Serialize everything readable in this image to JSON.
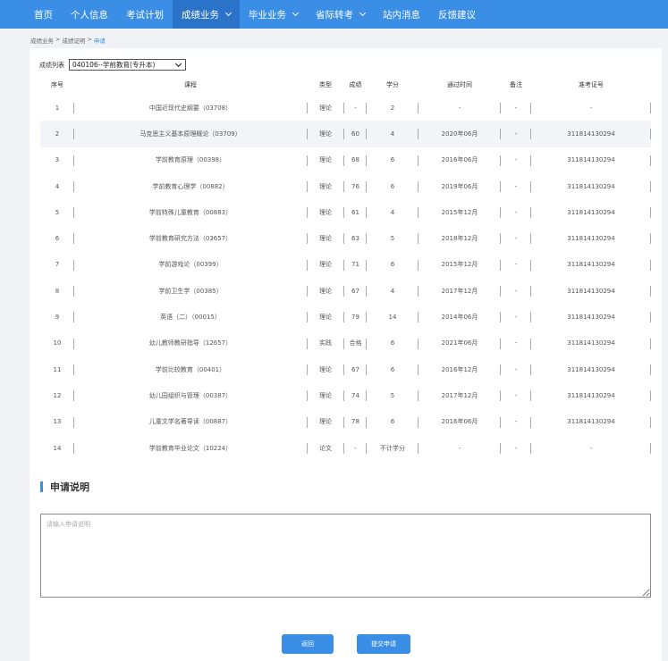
{
  "nav": [
    {
      "label": "首页",
      "dropdown": false,
      "active": false
    },
    {
      "label": "个人信息",
      "dropdown": false,
      "active": false
    },
    {
      "label": "考试计划",
      "dropdown": false,
      "active": false
    },
    {
      "label": "成绩业务",
      "dropdown": true,
      "active": true
    },
    {
      "label": "毕业业务",
      "dropdown": true,
      "active": false
    },
    {
      "label": "省际转考",
      "dropdown": true,
      "active": false
    },
    {
      "label": "站内消息",
      "dropdown": false,
      "active": false
    },
    {
      "label": "反馈建议",
      "dropdown": false,
      "active": false
    }
  ],
  "breadcrumb": {
    "item1": "成绩业务",
    "sep": ">",
    "item2": "成绩证明",
    "current": "申请"
  },
  "filter": {
    "label": "成绩列表",
    "selected": "040106--学前教育(专升本)"
  },
  "table": {
    "headers": {
      "no": "序号",
      "course": "课程",
      "type": "类型",
      "score": "成绩",
      "credit": "学分",
      "date": "通过时间",
      "note": "备注",
      "ticket": "准考证号"
    },
    "rows": [
      {
        "no": "1",
        "course": "中国近现代史纲要（03708）",
        "type": "理论",
        "score": "-",
        "credit": "2",
        "date": "-",
        "note": "-",
        "ticket": "-"
      },
      {
        "no": "2",
        "course": "马克思主义基本原理概论（03709）",
        "type": "理论",
        "score": "60",
        "credit": "4",
        "date": "2020年06月",
        "note": "-",
        "ticket": "311814130294"
      },
      {
        "no": "3",
        "course": "学前教育原理（00398）",
        "type": "理论",
        "score": "68",
        "credit": "6",
        "date": "2016年06月",
        "note": "-",
        "ticket": "311814130294"
      },
      {
        "no": "4",
        "course": "学前教育心理学（00882）",
        "type": "理论",
        "score": "76",
        "credit": "6",
        "date": "2019年06月",
        "note": "-",
        "ticket": "311814130294"
      },
      {
        "no": "5",
        "course": "学前特殊儿童教育（00883）",
        "type": "理论",
        "score": "61",
        "credit": "4",
        "date": "2015年12月",
        "note": "-",
        "ticket": "311814130294"
      },
      {
        "no": "6",
        "course": "学前教育研究方法（03657）",
        "type": "理论",
        "score": "63",
        "credit": "5",
        "date": "2018年12月",
        "note": "-",
        "ticket": "311814130294"
      },
      {
        "no": "7",
        "course": "学前游戏论（00399）",
        "type": "理论",
        "score": "71",
        "credit": "6",
        "date": "2015年12月",
        "note": "-",
        "ticket": "311814130294"
      },
      {
        "no": "8",
        "course": "学前卫生学（00385）",
        "type": "理论",
        "score": "67",
        "credit": "4",
        "date": "2017年12月",
        "note": "-",
        "ticket": "311814130294"
      },
      {
        "no": "9",
        "course": "英语（二）（00015）",
        "type": "理论",
        "score": "79",
        "credit": "14",
        "date": "2014年06月",
        "note": "-",
        "ticket": "311814130294"
      },
      {
        "no": "10",
        "course": "幼儿教师教研指导（12657）",
        "type": "实践",
        "score": "合格",
        "credit": "6",
        "date": "2021年06月",
        "note": "-",
        "ticket": "311814130294"
      },
      {
        "no": "11",
        "course": "学前比较教育（00401）",
        "type": "理论",
        "score": "67",
        "credit": "6",
        "date": "2016年12月",
        "note": "-",
        "ticket": "311814130294"
      },
      {
        "no": "12",
        "course": "幼儿园组织与管理（00387）",
        "type": "理论",
        "score": "74",
        "credit": "5",
        "date": "2017年12月",
        "note": "-",
        "ticket": "311814130294"
      },
      {
        "no": "13",
        "course": "儿童文学名著导读（00887）",
        "type": "理论",
        "score": "78",
        "credit": "6",
        "date": "2016年06月",
        "note": "-",
        "ticket": "311814130294"
      },
      {
        "no": "14",
        "course": "学前教育毕业论文（10224）",
        "type": "论文",
        "score": "-",
        "credit": "不计学分",
        "date": "-",
        "note": "-",
        "ticket": "-"
      }
    ]
  },
  "application": {
    "title": "申请说明",
    "placeholder": "请输入申请说明"
  },
  "buttons": {
    "back": "返回",
    "submit": "提交申请"
  },
  "colors": {
    "primary": "#3a8ee6",
    "nav_active": "#2a73c8",
    "row_highlight": "#f3f4f8"
  }
}
